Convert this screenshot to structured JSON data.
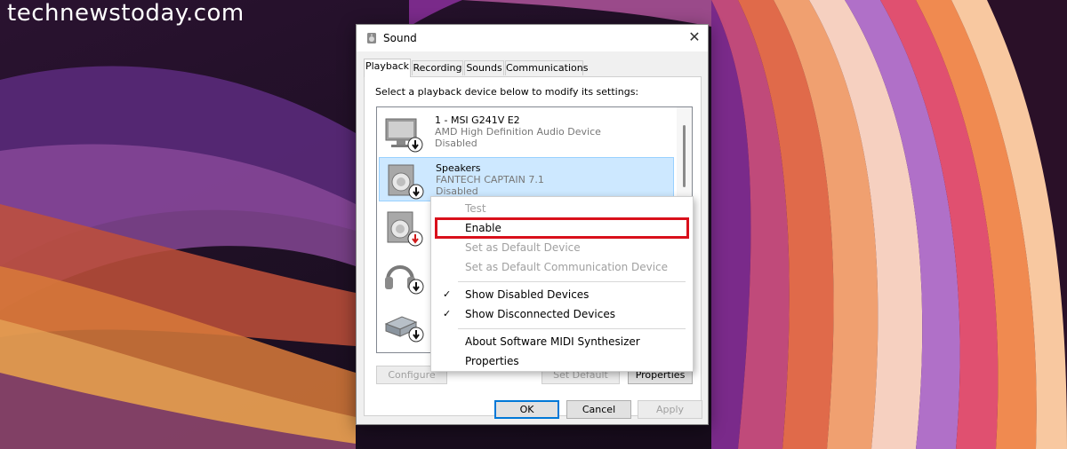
{
  "watermark": "technewstoday.com",
  "window": {
    "title": "Sound",
    "close": "✕"
  },
  "tabs": [
    {
      "label": "Playback",
      "active": true
    },
    {
      "label": "Recording",
      "active": false
    },
    {
      "label": "Sounds",
      "active": false
    },
    {
      "label": "Communications",
      "active": false
    }
  ],
  "instruction": "Select a playback device below to modify its settings:",
  "devices": [
    {
      "name": "1 - MSI G241V E2",
      "subtitle": "AMD High Definition Audio Device",
      "status": "Disabled",
      "icon": "monitor-icon",
      "selected": false
    },
    {
      "name": "Speakers",
      "subtitle": "FANTECH CAPTAIN 7.1",
      "status": "Disabled",
      "icon": "speaker-icon",
      "selected": true
    },
    {
      "name": "",
      "subtitle": "",
      "status": "",
      "icon": "speaker-icon",
      "selected": false
    },
    {
      "name": "",
      "subtitle": "",
      "status": "",
      "icon": "headphones-icon",
      "selected": false
    },
    {
      "name": "",
      "subtitle": "",
      "status": "",
      "icon": "audio-device-icon",
      "selected": false
    }
  ],
  "buttons": {
    "configure": "Configure",
    "set_default": "Set Default",
    "properties": "Properties",
    "ok": "OK",
    "cancel": "Cancel",
    "apply": "Apply"
  },
  "context_menu": {
    "items": [
      {
        "label": "Test",
        "enabled": false,
        "checked": false
      },
      {
        "label": "Enable",
        "enabled": true,
        "checked": false,
        "highlighted": true
      },
      {
        "label": "Set as Default Device",
        "enabled": false,
        "checked": false
      },
      {
        "label": "Set as Default Communication Device",
        "enabled": false,
        "checked": false
      },
      {
        "label": "Show Disabled Devices",
        "enabled": true,
        "checked": true
      },
      {
        "label": "Show Disconnected Devices",
        "enabled": true,
        "checked": true
      },
      {
        "label": "About Software MIDI Synthesizer",
        "enabled": true,
        "checked": false
      },
      {
        "label": "Properties",
        "enabled": true,
        "checked": false
      }
    ],
    "check_glyph": "✓"
  },
  "colors": {
    "highlight": "#d9101b",
    "selection": "#cde8ff",
    "accent": "#0078d7"
  }
}
